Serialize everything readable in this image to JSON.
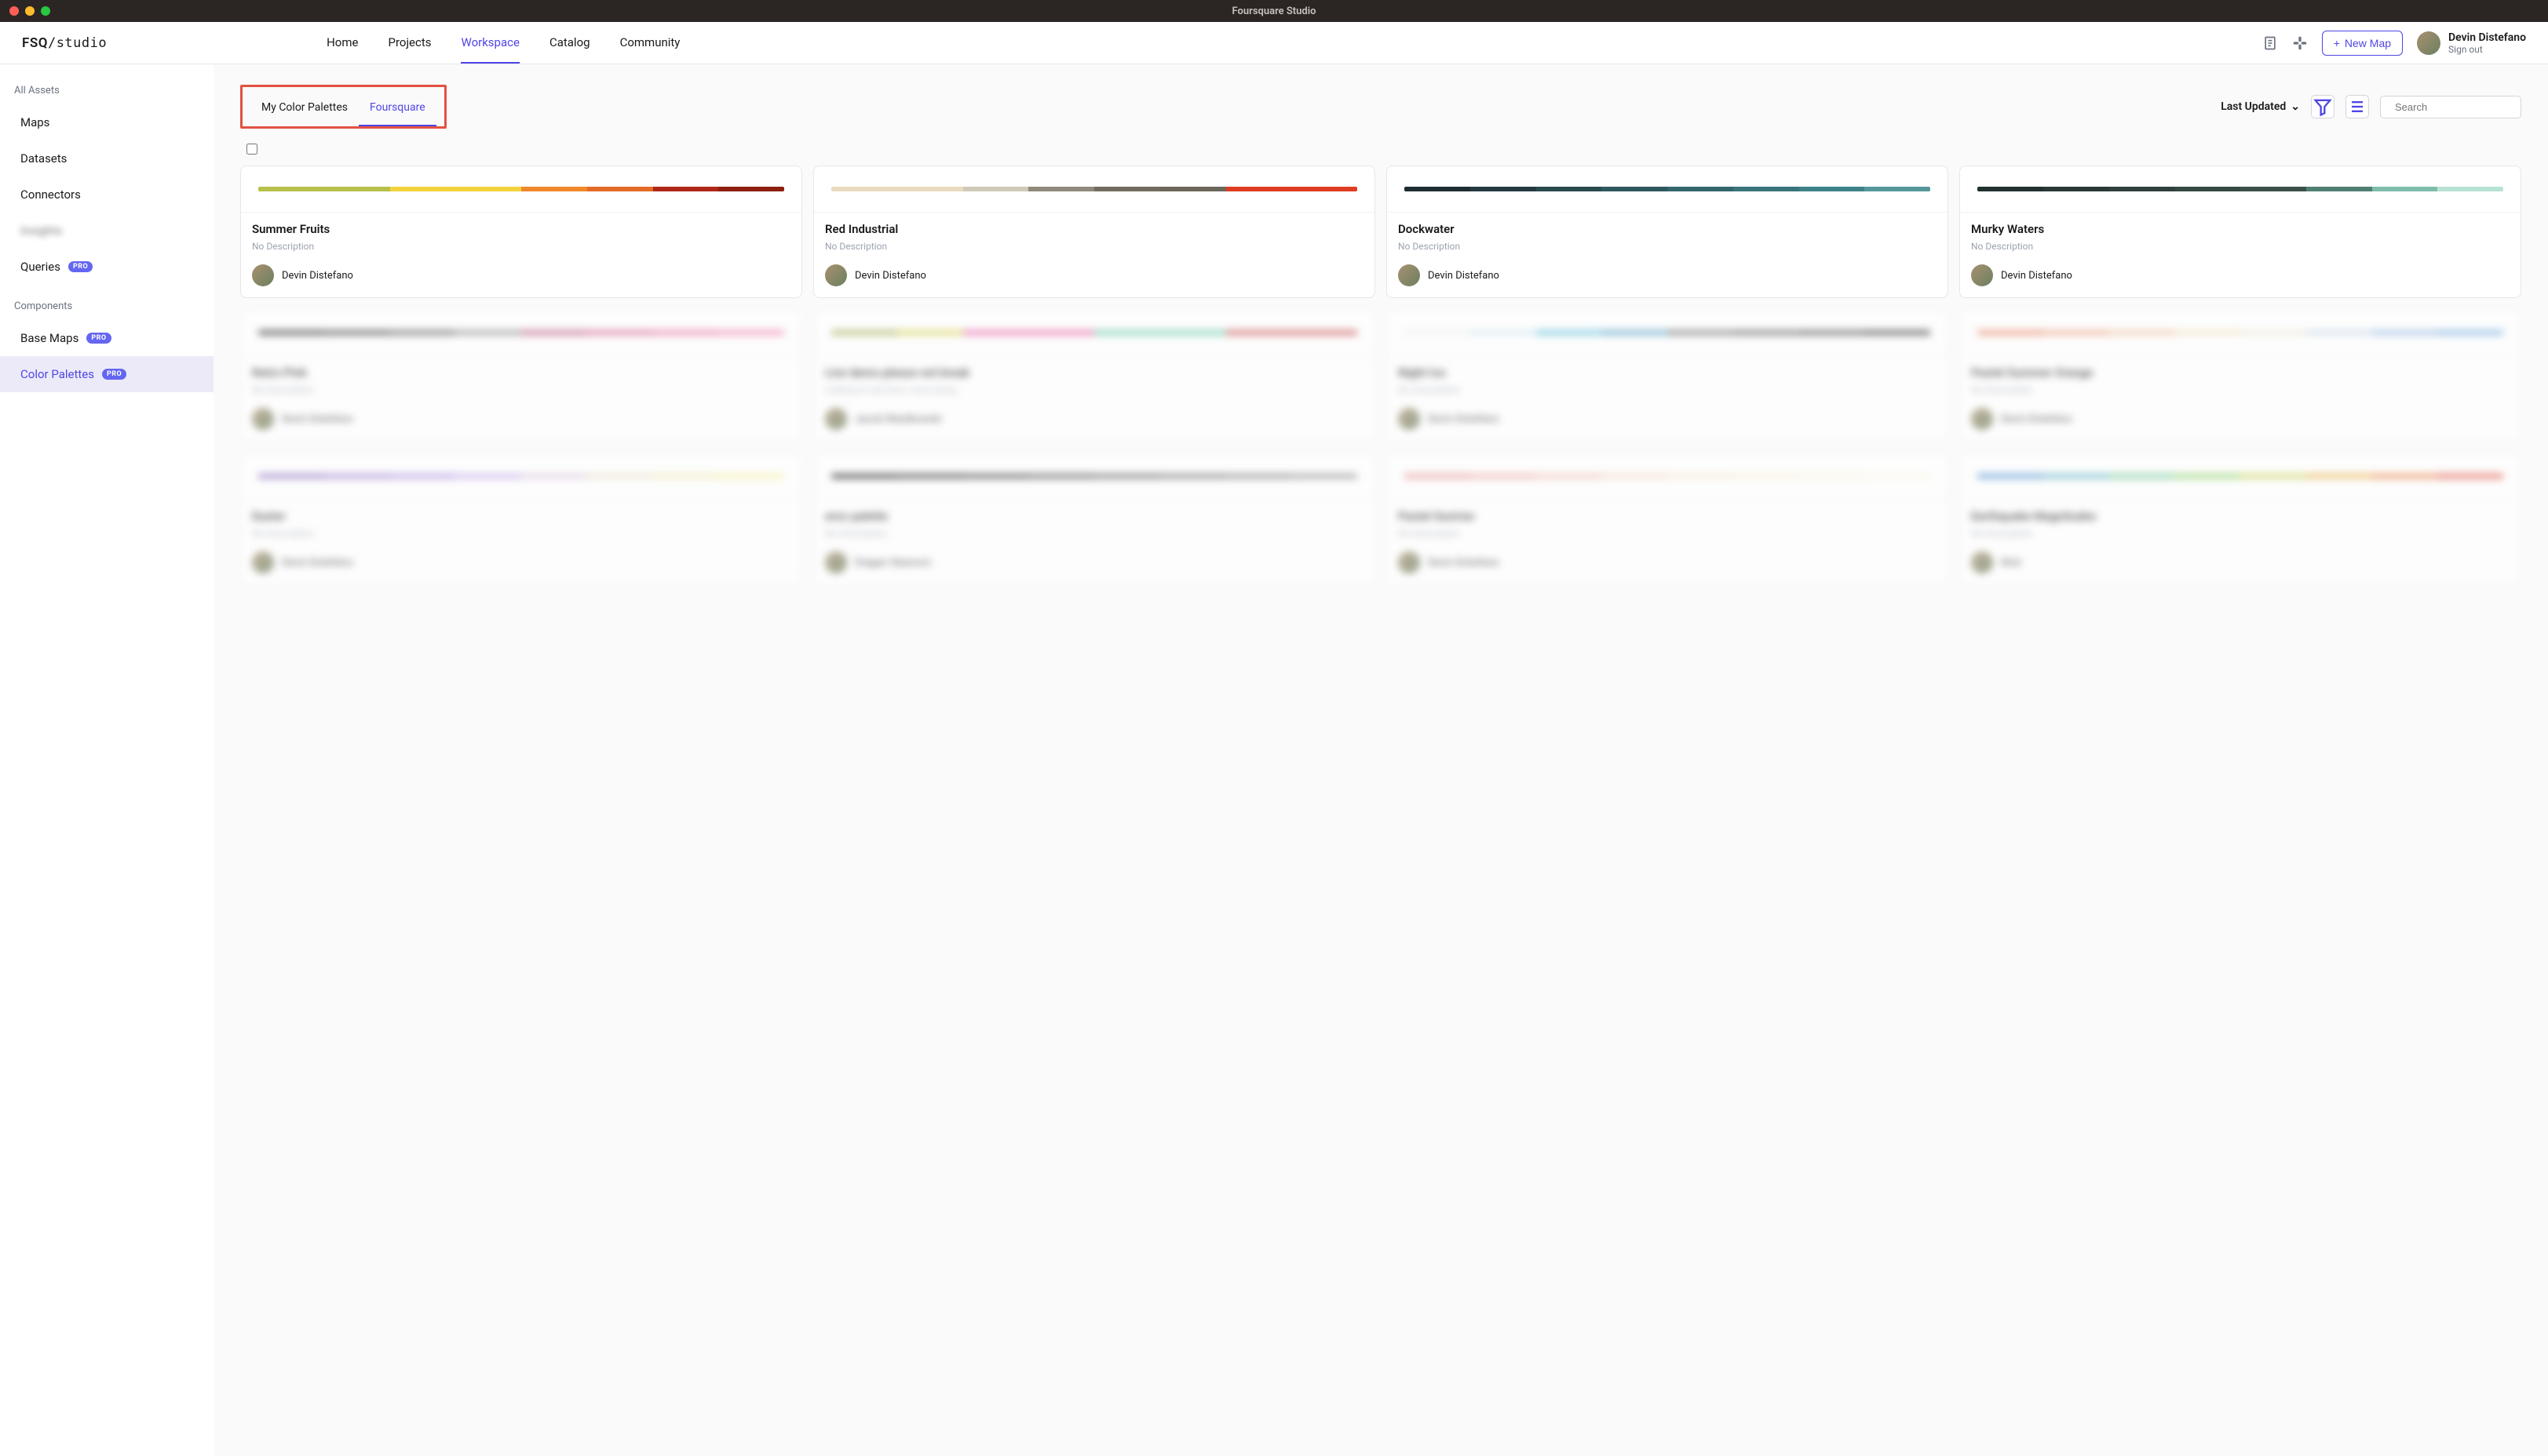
{
  "window": {
    "title": "Foursquare Studio"
  },
  "logo": {
    "prefix": "FSQ",
    "suffix": "/studio"
  },
  "nav": {
    "home": "Home",
    "projects": "Projects",
    "workspace": "Workspace",
    "catalog": "Catalog",
    "community": "Community"
  },
  "header": {
    "new_map": "New Map",
    "user_name": "Devin Distefano",
    "sign_out": "Sign out"
  },
  "sidebar": {
    "all_assets": "All Assets",
    "maps": "Maps",
    "datasets": "Datasets",
    "connectors": "Connectors",
    "insights": "Insights",
    "queries": "Queries",
    "components": "Components",
    "base_maps": "Base Maps",
    "color_palettes": "Color Palettes",
    "pro": "PRO"
  },
  "tabs": {
    "my": "My Color Palettes",
    "fsq": "Foursquare"
  },
  "sort": {
    "label": "Last Updated"
  },
  "search": {
    "placeholder": "Search"
  },
  "cards": [
    {
      "title": "Summer Fruits",
      "desc": "No Description",
      "author": "Devin Distefano",
      "colors": [
        "#b7c04a",
        "#b7c04a",
        "#f2d33c",
        "#f2d33c",
        "#f0892b",
        "#e36b27",
        "#b02617",
        "#8c1f10"
      ]
    },
    {
      "title": "Red Industrial",
      "desc": "No Description",
      "author": "Devin Distefano",
      "colors": [
        "#e9dabf",
        "#e9dabf",
        "#cfc9b8",
        "#8f8a7c",
        "#716c60",
        "#6b665a",
        "#df3d21",
        "#df3d21"
      ]
    },
    {
      "title": "Dockwater",
      "desc": "No Description",
      "author": "Devin Distefano",
      "colors": [
        "#1e2d32",
        "#243a40",
        "#2a494f",
        "#2e585e",
        "#33666c",
        "#387479",
        "#3d8287",
        "#54989b"
      ]
    },
    {
      "title": "Murky Waters",
      "desc": "No Description",
      "author": "Devin Distefano",
      "colors": [
        "#22302f",
        "#293836",
        "#2f403d",
        "#354844",
        "#3b504b",
        "#4f7e73",
        "#7fbcab",
        "#b8e2d4"
      ]
    }
  ],
  "blur_cards": [
    {
      "title": "Retro Pink",
      "desc": "No Description",
      "author": "Devin Distefano",
      "colors": [
        "#2b2b2b",
        "#3a3a3a",
        "#555",
        "#888",
        "#b64d7a",
        "#d45a8a",
        "#e86b9a",
        "#f07daa"
      ]
    },
    {
      "title": "Live demo please not break",
      "desc": "nothing to see here, more along",
      "author": "Jacob Wasilkowski",
      "colors": [
        "#9fa84a",
        "#d6d04e",
        "#e85aa0",
        "#e85aa0",
        "#5ec9a0",
        "#5ec9a0",
        "#c84848",
        "#c84848"
      ]
    },
    {
      "title": "Night Ice",
      "desc": "No Description",
      "author": "Devin Distefano",
      "colors": [
        "#f0f0f0",
        "#d0e8f0",
        "#5abcd8",
        "#4a9cc0",
        "#666",
        "#555",
        "#444",
        "#333"
      ]
    },
    {
      "title": "Pastel Summer Orange",
      "desc": "No Description",
      "author": "Devin Distefano",
      "colors": [
        "#e88060",
        "#eba080",
        "#efc0a0",
        "#f3dfc0",
        "#f0e8d8",
        "#c8d8e8",
        "#90b8e0",
        "#70a8e0"
      ]
    },
    {
      "title": "Easter",
      "desc": "No Description",
      "author": "Devin Distefano",
      "colors": [
        "#8a6bbf",
        "#9a7bcf",
        "#ab8bdf",
        "#c0a8e8",
        "#d8c8e0",
        "#e8dfc8",
        "#f0e8b0",
        "#f8f0a0"
      ]
    },
    {
      "title": "ernc palette",
      "desc": "No Description",
      "author": "Dragan Okanovic",
      "colors": [
        "#1a1a1a",
        "#2a2a2a",
        "#3a3a3a",
        "#4a4a4a",
        "#5a5a5a",
        "#6a6a6a",
        "#7a7a7a",
        "#8a8a8a"
      ]
    },
    {
      "title": "Pastel Sunrise",
      "desc": "No Description",
      "author": "Devin Distefano",
      "colors": [
        "#e89090",
        "#eba8a0",
        "#efc0b0",
        "#f3d8c0",
        "#f6e8d0",
        "#f8efd8",
        "#faf4e0",
        "#fcf8e8"
      ]
    },
    {
      "title": "Earthquake Magnitudes",
      "desc": "No Description",
      "author": "Nick",
      "colors": [
        "#4a90d0",
        "#5ab0c0",
        "#6ac890",
        "#8ad060",
        "#c8d050",
        "#e8b040",
        "#e88040",
        "#e05040"
      ]
    }
  ]
}
